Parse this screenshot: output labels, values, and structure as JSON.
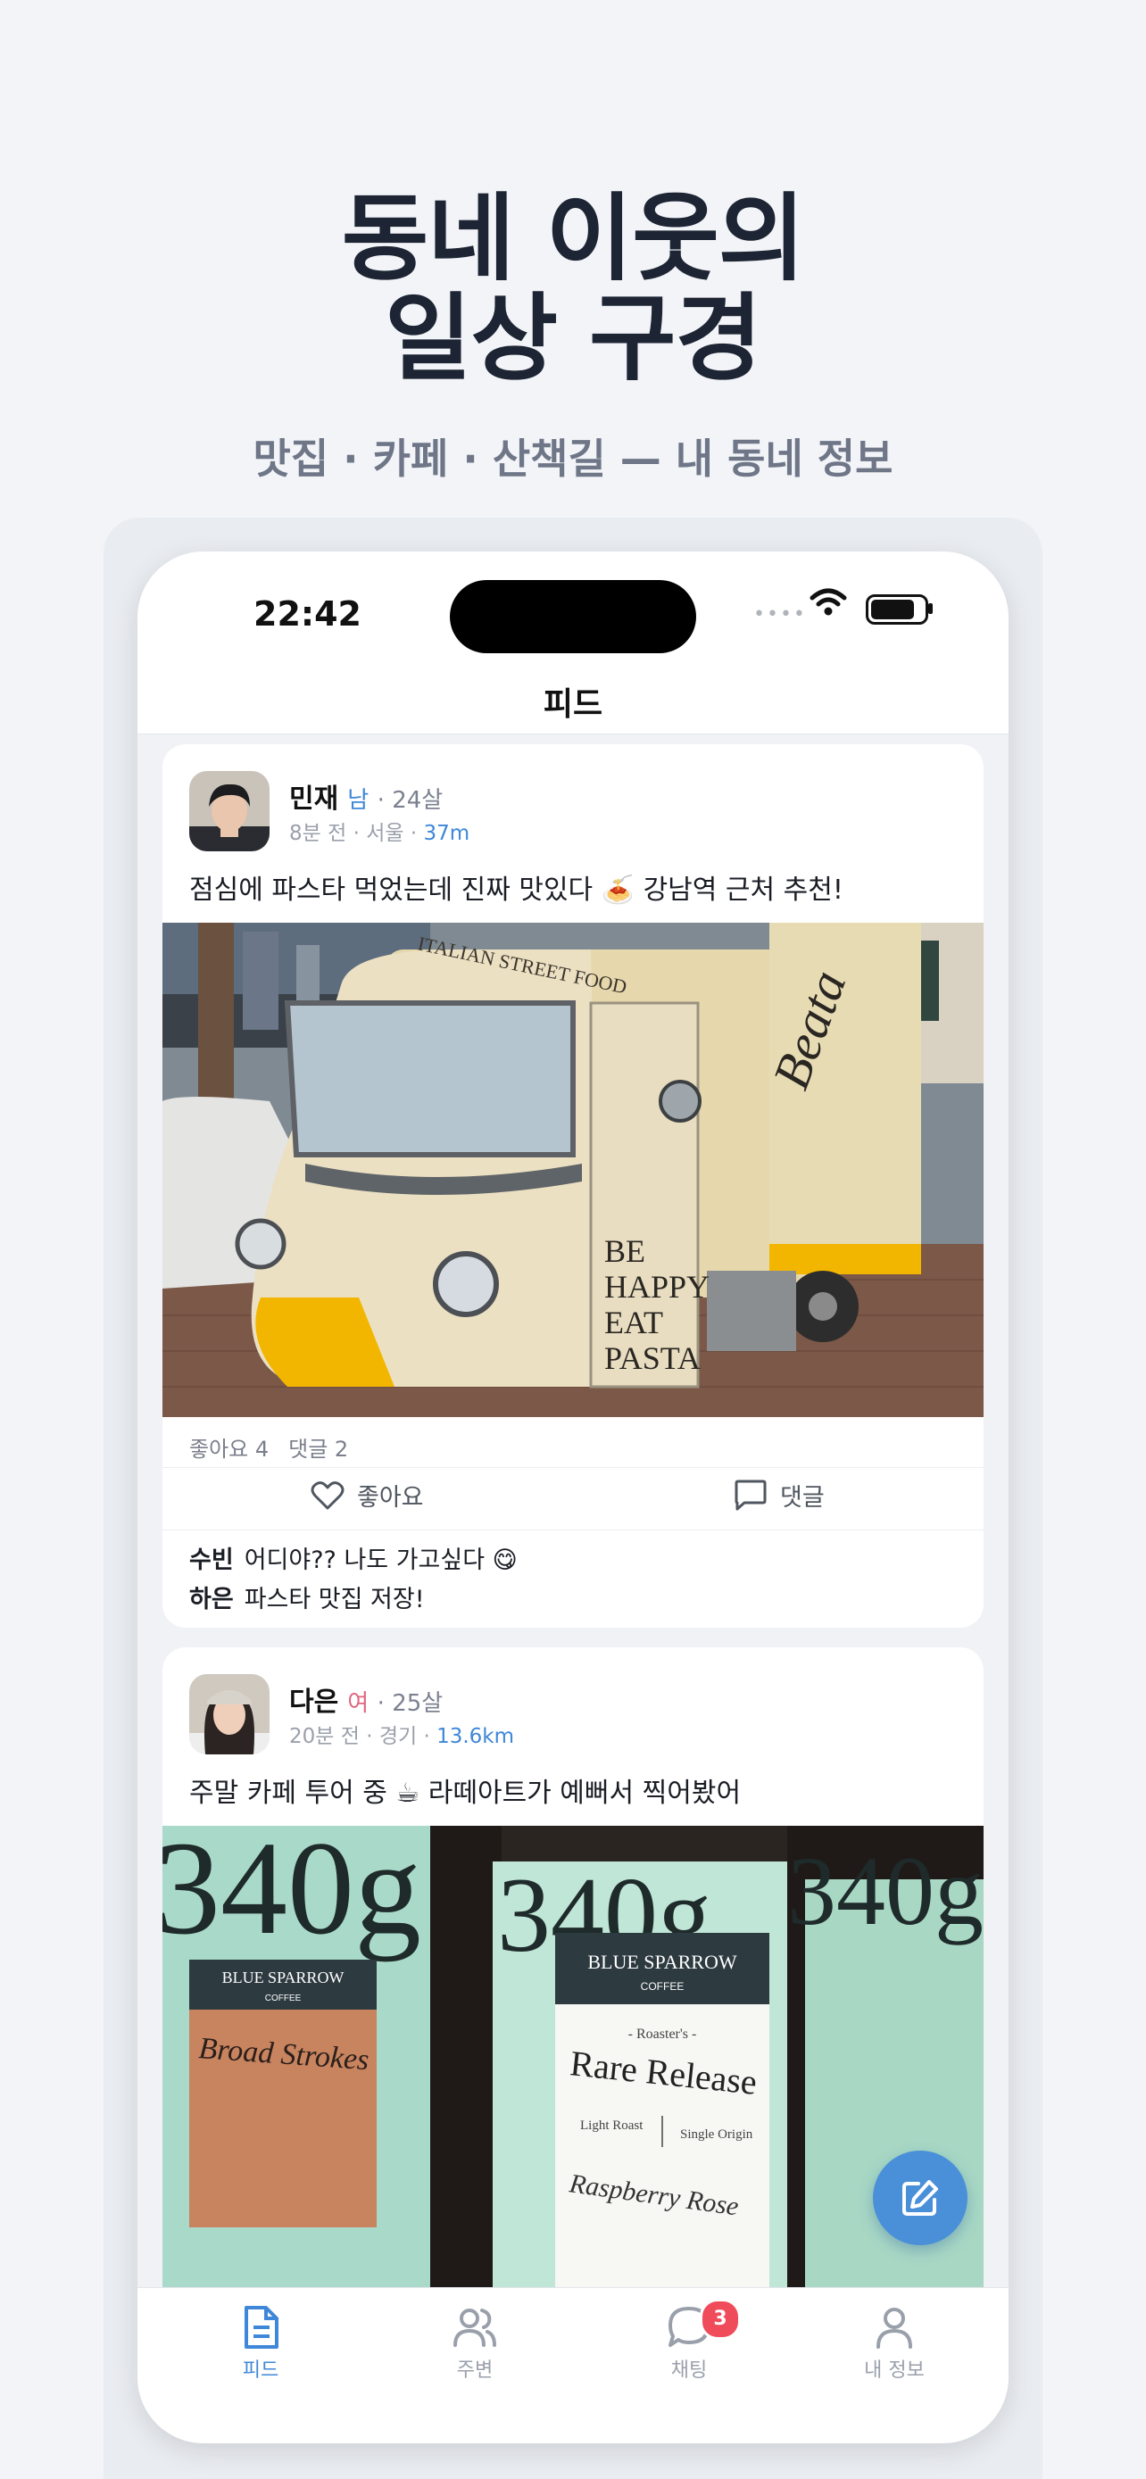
{
  "hero": {
    "title_line1": "동네 이웃의",
    "title_line2": "일상 구경",
    "subtitle": "맛집 · 카페 · 산책길 — 내 동네 정보"
  },
  "status_bar": {
    "time": "22:42",
    "signal": "••••"
  },
  "nav": {
    "title": "피드"
  },
  "posts": [
    {
      "author": "민재",
      "gender": "남",
      "age": "· 24살",
      "time_location": "8분 전 · 서울 · ",
      "distance": "37m",
      "text": "점심에 파스타 먹었는데 진짜 맛있다 🍝 강남역 근처 추천!",
      "likes": "좋아요 4",
      "comments_count": "댓글 2",
      "like_label": "좋아요",
      "comment_label": "댓글",
      "truck_text": [
        "BE",
        "HAPPY",
        "EAT",
        "PASTA"
      ],
      "truck_sign": "ITALIAN STREET FOOD",
      "truck_logo": "Beata",
      "comments": [
        {
          "author": "수빈",
          "text": "어디야?? 나도 가고싶다 😋"
        },
        {
          "author": "하은",
          "text": "파스타 맛집 저장!"
        }
      ]
    },
    {
      "author": "다은",
      "gender": "여",
      "age": "· 25살",
      "time_location": "20분 전 · 경기 · ",
      "distance": "13.6km",
      "text": "주말 카페 투어 중 ☕ 라떼아트가 예뻐서 찍어봤어",
      "bag_left": {
        "weight": "340g",
        "brand": "BLUE SPARROW",
        "brand_sub": "COFFEE",
        "product": "Broad Strokes"
      },
      "bag_right": {
        "weight": "340g",
        "brand": "BLUE SPARROW",
        "brand_sub": "COFFEE",
        "series": "- Roaster's -",
        "product": "Rare Release",
        "roast": "Light Roast",
        "origin": "Single Origin",
        "variety": "Raspberry Rose"
      }
    }
  ],
  "tabs": [
    {
      "label": "피드",
      "icon": "document-icon",
      "active": true
    },
    {
      "label": "주변",
      "icon": "people-icon"
    },
    {
      "label": "채팅",
      "icon": "chat-bubble-icon",
      "badge": "3"
    },
    {
      "label": "내 정보",
      "icon": "person-icon"
    }
  ],
  "colors": {
    "accent": "#3f87d8",
    "badge": "#ef4b5b",
    "female": "#e0667f"
  }
}
